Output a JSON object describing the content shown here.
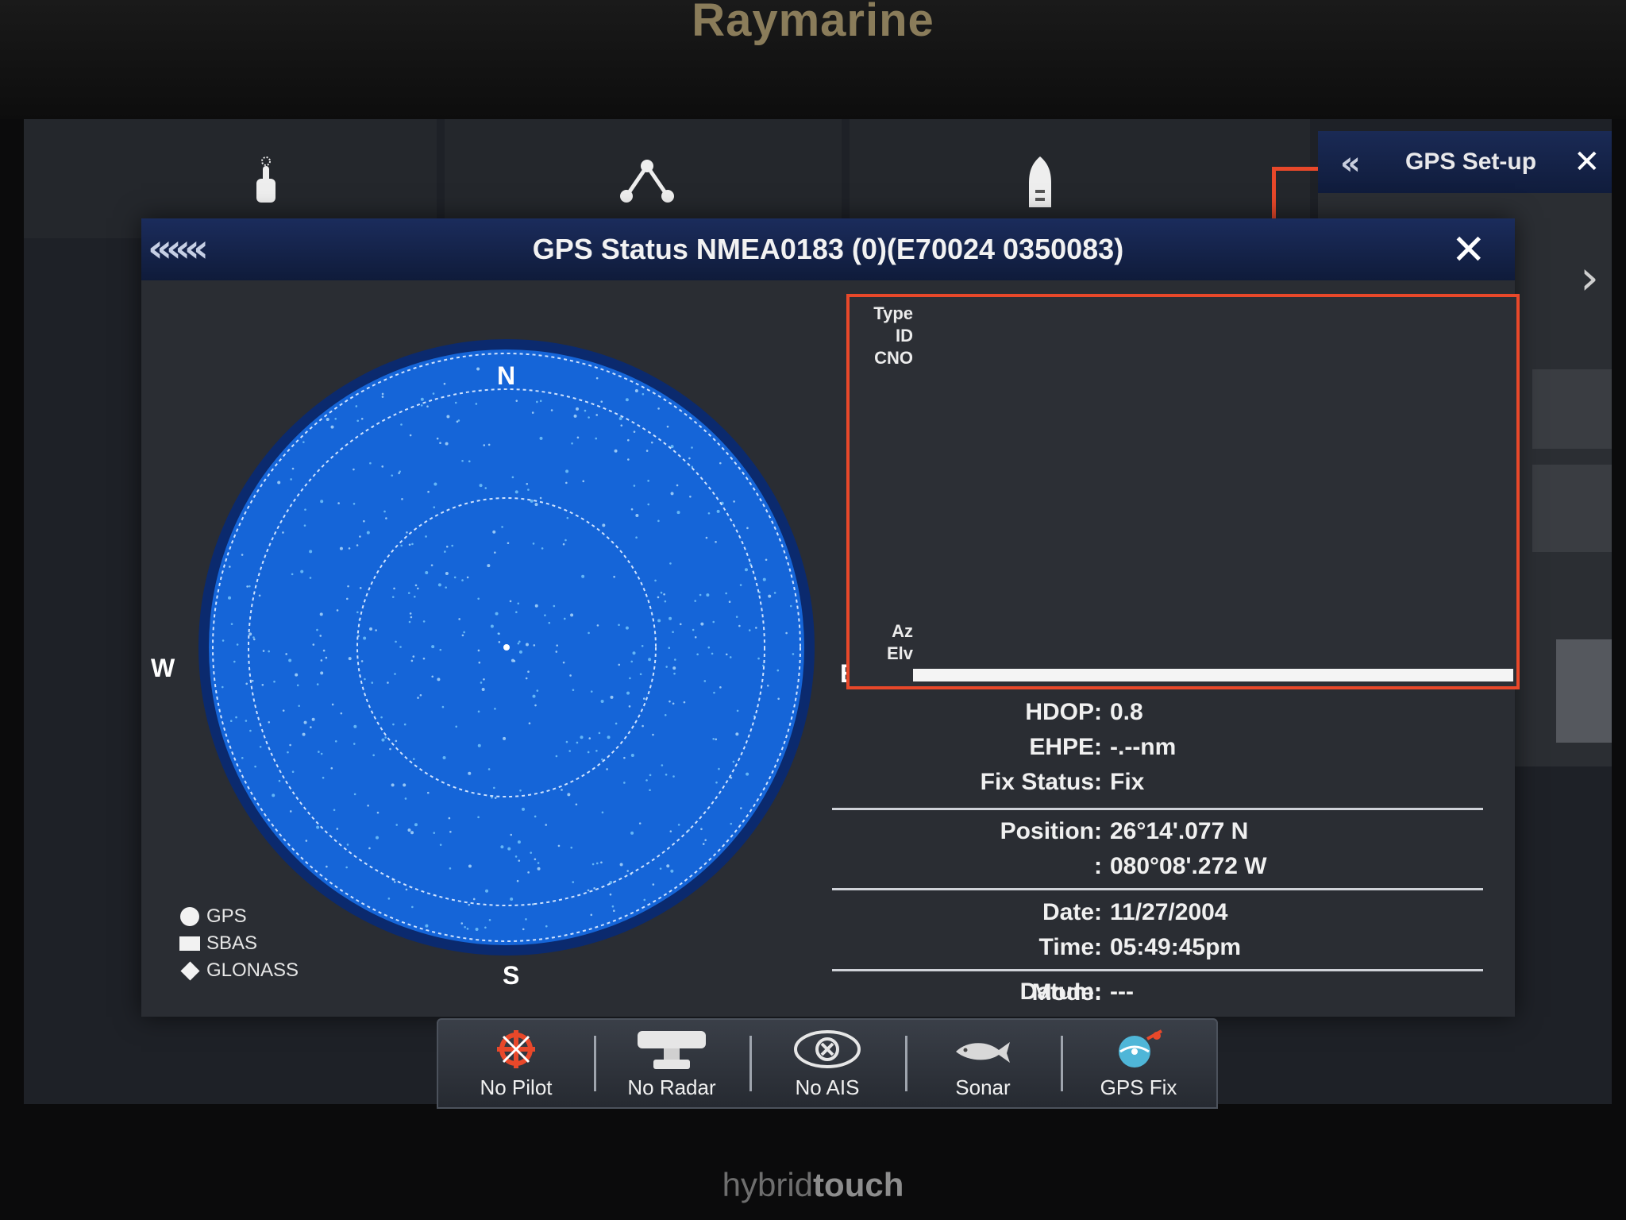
{
  "device": {
    "brand": "Raymarine",
    "model_prefix": "hybrid",
    "model_suffix": "touch"
  },
  "background_panel": {
    "title": "GPS Set-up"
  },
  "dialog": {
    "title": "GPS Status NMEA0183 (0)(E70024 0350083)"
  },
  "skyview": {
    "compass": {
      "n": "N",
      "s": "S",
      "e": "E",
      "w": "W"
    },
    "legend": [
      {
        "label": "GPS",
        "symbol": "circle"
      },
      {
        "label": "SBAS",
        "symbol": "square"
      },
      {
        "label": "GLONASS",
        "symbol": "diamond"
      }
    ],
    "colors": {
      "sky": "#1565d8",
      "ring": "#cfe3ff",
      "border": "#0b2a6e"
    }
  },
  "signal_chart": {
    "row_labels": {
      "type": "Type",
      "id": "ID",
      "cno": "CNO",
      "az": "Az",
      "elv": "Elv"
    }
  },
  "status": {
    "hdop_label": "HDOP:",
    "hdop_value": "0.8",
    "ehpe_label": "EHPE:",
    "ehpe_value": "-.--nm",
    "fix_label": "Fix Status:",
    "fix_value": "Fix",
    "position_label": "Position:",
    "position_lat": "26°14'.077 N",
    "position_lon_label": ":",
    "position_lon": "080°08'.272 W",
    "date_label": "Date:",
    "date_value": "11/27/2004",
    "time_label": "Time:",
    "time_value": "05:49:45pm",
    "mode_label": "Mode:",
    "mode_value": "",
    "datum_label": "Datum:",
    "datum_value": "---"
  },
  "bottom_bar": [
    {
      "label": "No Pilot",
      "icon": "pilot-icon"
    },
    {
      "label": "No Radar",
      "icon": "radar-icon"
    },
    {
      "label": "No AIS",
      "icon": "ais-icon"
    },
    {
      "label": "Sonar",
      "icon": "fish-icon"
    },
    {
      "label": "GPS Fix",
      "icon": "gps-fix-icon"
    }
  ],
  "accent_color": "#e8482a"
}
